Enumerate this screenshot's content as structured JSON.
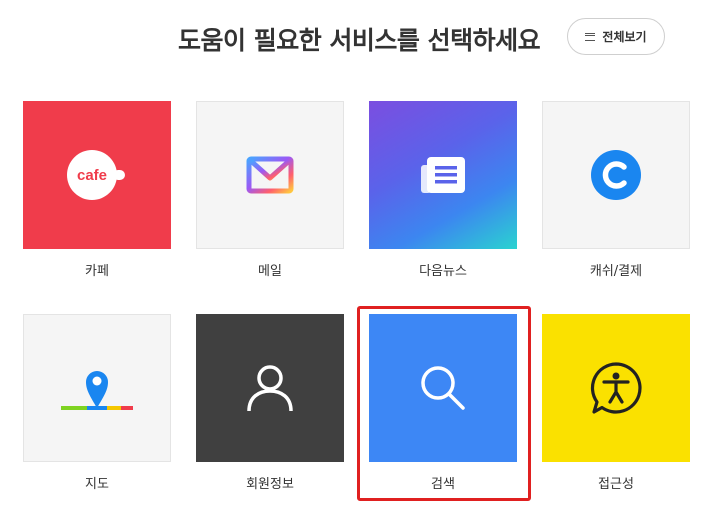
{
  "header": {
    "title": "도움이 필요한 서비스를 선택하세요",
    "view_all_label": "전체보기"
  },
  "services": [
    {
      "label": "카페",
      "icon": "cafe-icon",
      "icon_text": "cafe",
      "color": "#f03c4b"
    },
    {
      "label": "메일",
      "icon": "mail-icon",
      "color": "#f5f5f5"
    },
    {
      "label": "다음뉴스",
      "icon": "news-icon",
      "color": "#6c5ce7"
    },
    {
      "label": "캐쉬/결제",
      "icon": "cash-c-icon",
      "color": "#f5f5f5"
    },
    {
      "label": "지도",
      "icon": "map-pin-icon",
      "color": "#f5f5f5"
    },
    {
      "label": "회원정보",
      "icon": "user-icon",
      "color": "#404040"
    },
    {
      "label": "검색",
      "icon": "search-icon",
      "color": "#3d87f5"
    },
    {
      "label": "접근성",
      "icon": "accessibility-icon",
      "color": "#fae100"
    }
  ],
  "selected_service": "검색",
  "colors": {
    "selection_border": "#e02020",
    "cafe_red": "#f03c4b",
    "search_blue": "#3d87f5",
    "accessibility_yellow": "#fae100",
    "user_dark": "#404040",
    "cash_blue": "#1a86f0"
  }
}
